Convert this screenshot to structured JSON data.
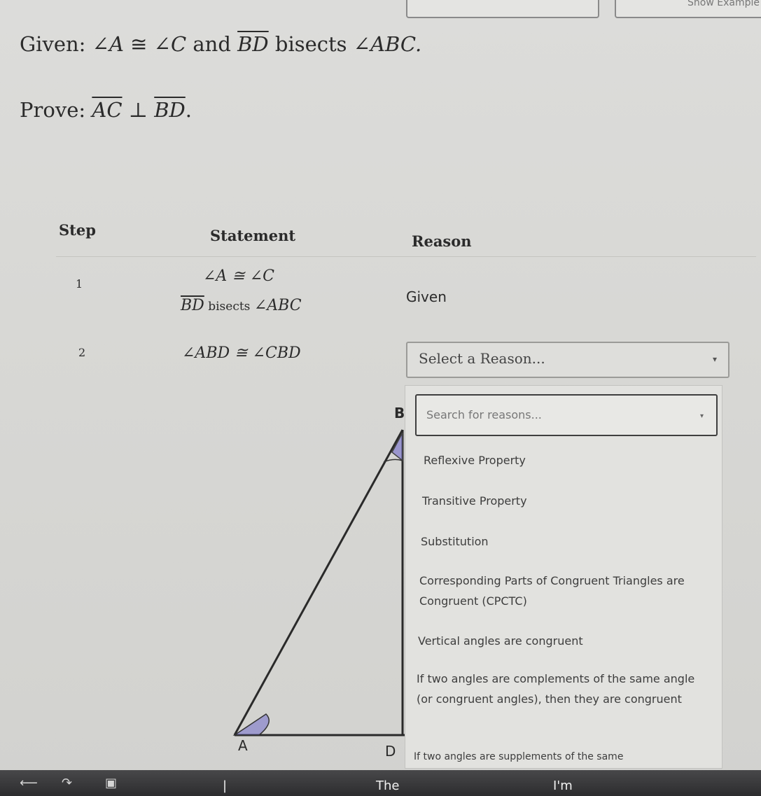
{
  "top_right_label": "Show Example",
  "given": {
    "label": "Given:",
    "angle1": "∠A",
    "cong": " ≅ ",
    "angle2": "∠C",
    "and": " and ",
    "segment": "BD",
    "bisects": " bisects ",
    "angle3": "∠ABC."
  },
  "prove": {
    "label": "Prove:",
    "seg1": "AC",
    "perp": " ⊥ ",
    "seg2": "BD",
    "period": "."
  },
  "table": {
    "headers": {
      "step": "Step",
      "statement": "Statement",
      "reason": "Reason"
    },
    "rows": [
      {
        "step": "1",
        "statement_line1": "∠A ≅ ∠C",
        "statement_line2_seg": "BD",
        "statement_line2_text": " bisects ",
        "statement_line2_angle": "∠ABC",
        "reason": "Given"
      },
      {
        "step": "2",
        "statement": "∠ABD ≅ ∠CBD",
        "reason_placeholder": "Select a Reason..."
      }
    ]
  },
  "dropdown": {
    "search_placeholder": "Search for reasons...",
    "options": [
      "Reflexive Property",
      "Transitive Property",
      "Substitution",
      "Corresponding Parts of Congruent Triangles are Congruent (CPCTC)",
      "Vertical angles are congruent",
      "If two angles are complements of the same angle (or congruent angles), then they are congruent",
      "If two angles are supplements of the same"
    ]
  },
  "diagram": {
    "labels": {
      "b": "B",
      "a": "A",
      "d": "D"
    },
    "accent_color": "#6a63c9"
  },
  "taskbar": {
    "text1": "The",
    "text2": "I'm",
    "separator": "|"
  }
}
